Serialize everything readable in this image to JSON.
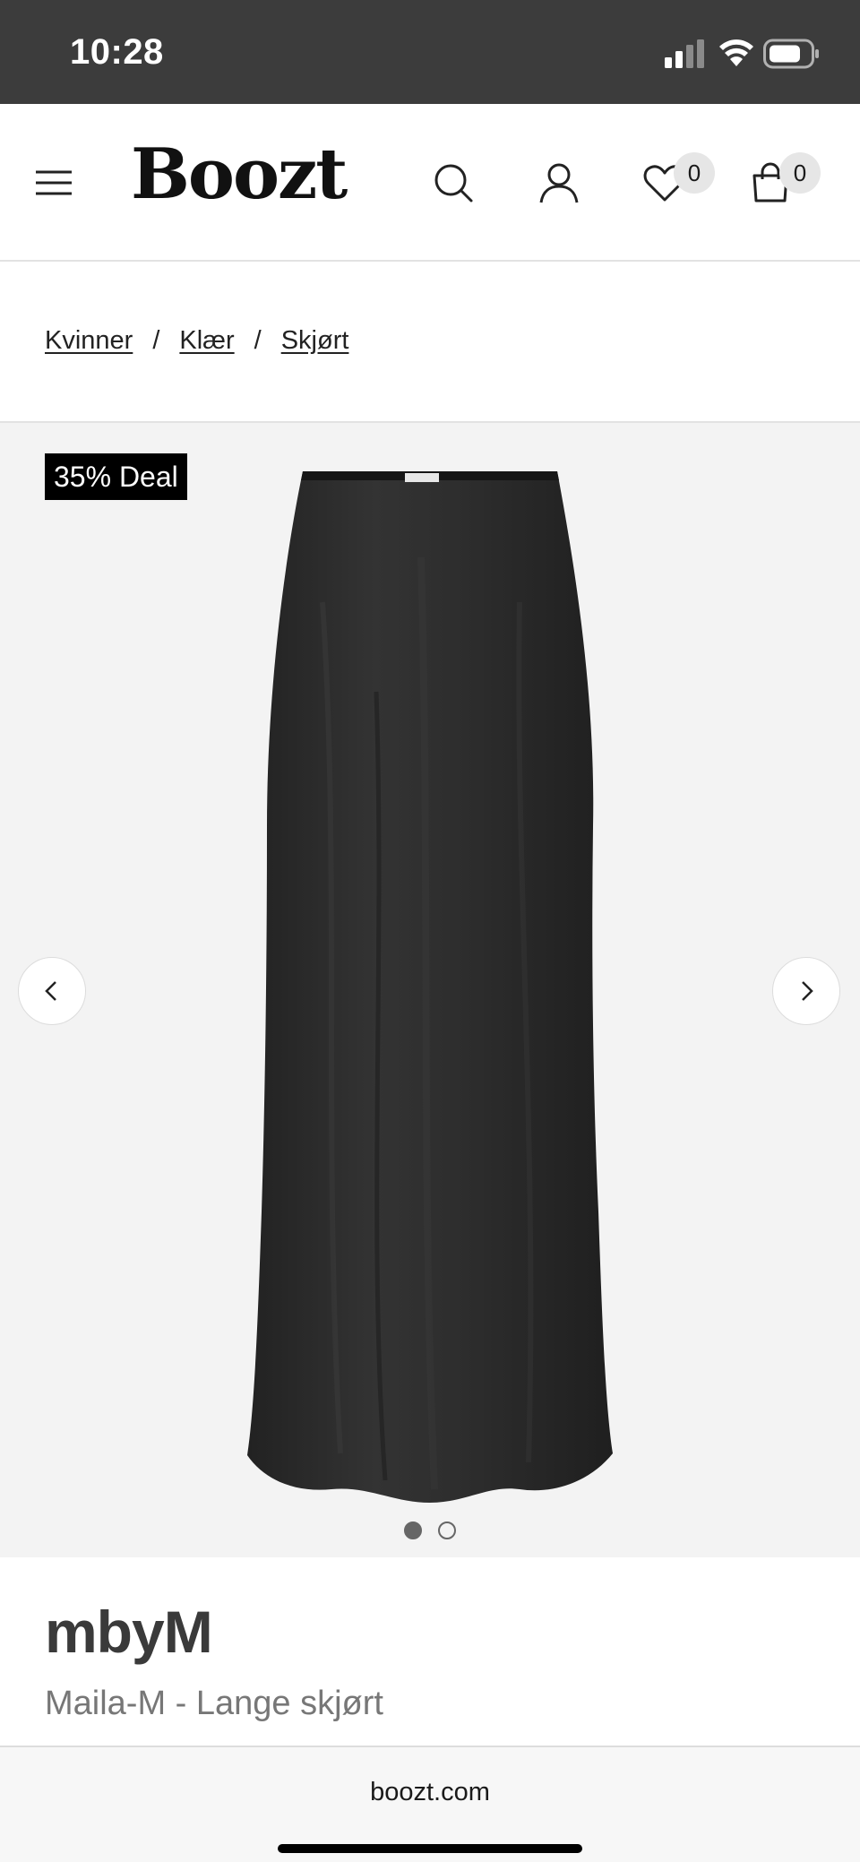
{
  "status_bar": {
    "time": "10:28",
    "icons": [
      "signal-icon",
      "wifi-icon",
      "battery-icon"
    ]
  },
  "header": {
    "logo": "Boozt",
    "icons": [
      "menu-icon",
      "search-icon",
      "user-icon",
      "heart-icon",
      "shopping-bag-icon"
    ],
    "wishlist_count": "0",
    "bag_count": "0"
  },
  "breadcrumb": {
    "items": [
      "Kvinner",
      "Klær",
      "Skjørt"
    ],
    "separator": "/"
  },
  "gallery": {
    "deal_badge": "35% Deal",
    "image_count": 2,
    "active_index": 1,
    "icons": [
      "chevron-left-icon",
      "chevron-right-icon"
    ]
  },
  "product": {
    "brand": "mbyM",
    "name": "Maila-M - Lange skjørt"
  },
  "browser": {
    "url": "boozt.com"
  },
  "colors": {
    "status_bar": "#3c3c3c",
    "gallery_bg": "#f3f3f3",
    "badge_bg": "#000000",
    "product_color": "#2b2b2b"
  }
}
